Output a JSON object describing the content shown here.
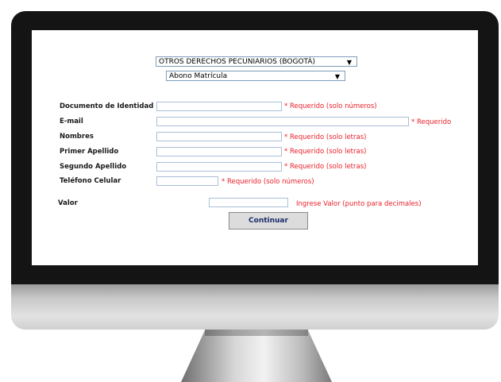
{
  "selects": {
    "category": "OTROS DERECHOS PECUNIARIOS (BOGOTÁ)",
    "concept": "Abono Matrícula",
    "arrow": "▼"
  },
  "form": {
    "document_label": "Documento de Identidad",
    "document_hint": "* Requerido (solo números)",
    "email_label": "E-mail",
    "email_hint": "* Requerido",
    "names_label": "Nombres",
    "names_hint": "* Requerido (solo letras)",
    "first_surname_label": "Primer Apellido",
    "first_surname_hint": "* Requerido (solo letras)",
    "second_surname_label": "Segundo Apellido",
    "second_surname_hint": "* Requerido (solo letras)",
    "phone_label": "Teléfono Celular",
    "phone_hint": "* Requerido (solo números)",
    "value_label": "Valor",
    "value_hint": "Ingrese Valor (punto para decimales)"
  },
  "submit_label": "Continuar"
}
